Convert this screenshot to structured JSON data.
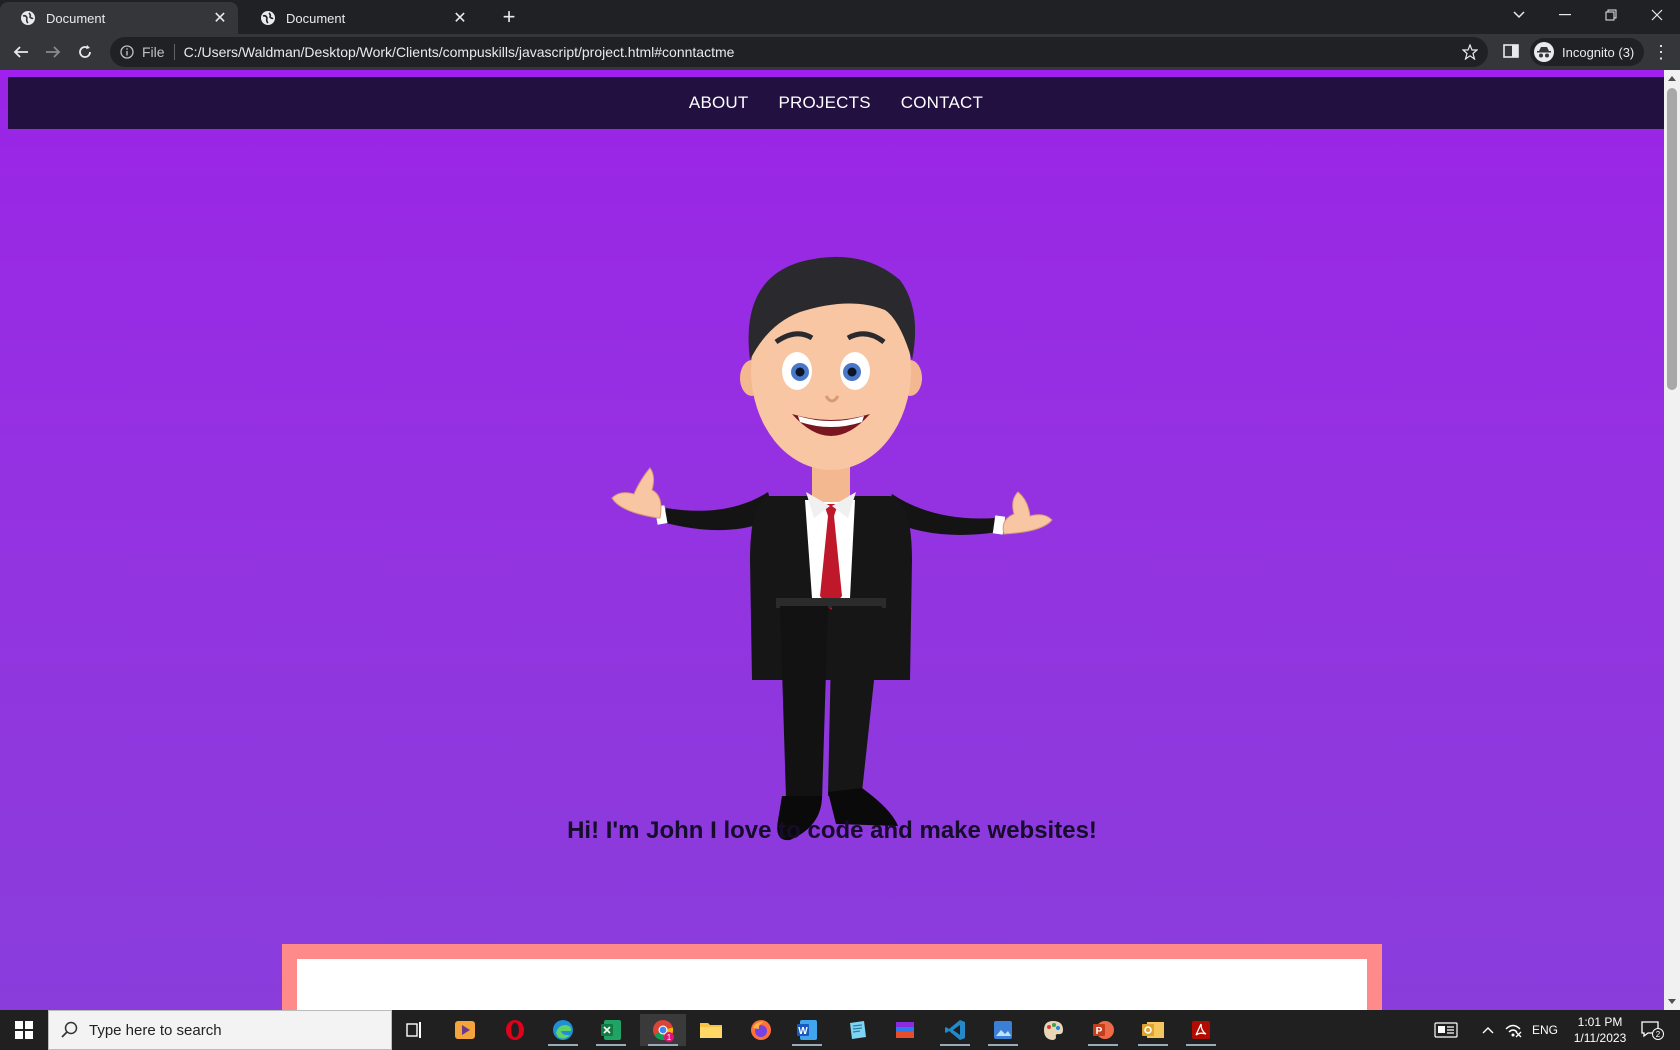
{
  "browser": {
    "tabs": [
      {
        "title": "Document",
        "active": true
      },
      {
        "title": "Document",
        "active": false
      }
    ],
    "url_scheme_label": "File",
    "url": "C:/Users/Waldman/Desktop/Work/Clients/compuskills/javascript/project.html#conntactme",
    "profile_label": "Incognito (3)"
  },
  "site": {
    "nav": [
      "ABOUT",
      "PROJECTS",
      "CONTACT"
    ],
    "tagline": "Hi! I'm John I love to code and make websites!",
    "colors": {
      "background": "#9b24e6",
      "nav": "#211040",
      "card_border": "#ff8a8a"
    }
  },
  "taskbar": {
    "search_placeholder": "Type here to search",
    "apps": [
      "task-view-icon",
      "media-player-icon",
      "opera-icon",
      "edge-icon",
      "excel-icon",
      "chrome-icon",
      "file-explorer-icon",
      "firefox-icon",
      "word-icon",
      "notepad-icon",
      "winrar-icon",
      "vscode-icon",
      "photos-icon",
      "paint-icon",
      "powerpoint-icon",
      "outlook-icon",
      "acrobat-icon"
    ],
    "chrome_badge": "1",
    "language": "ENG",
    "time": "1:01 PM",
    "date": "1/11/2023",
    "notifications": "2"
  }
}
